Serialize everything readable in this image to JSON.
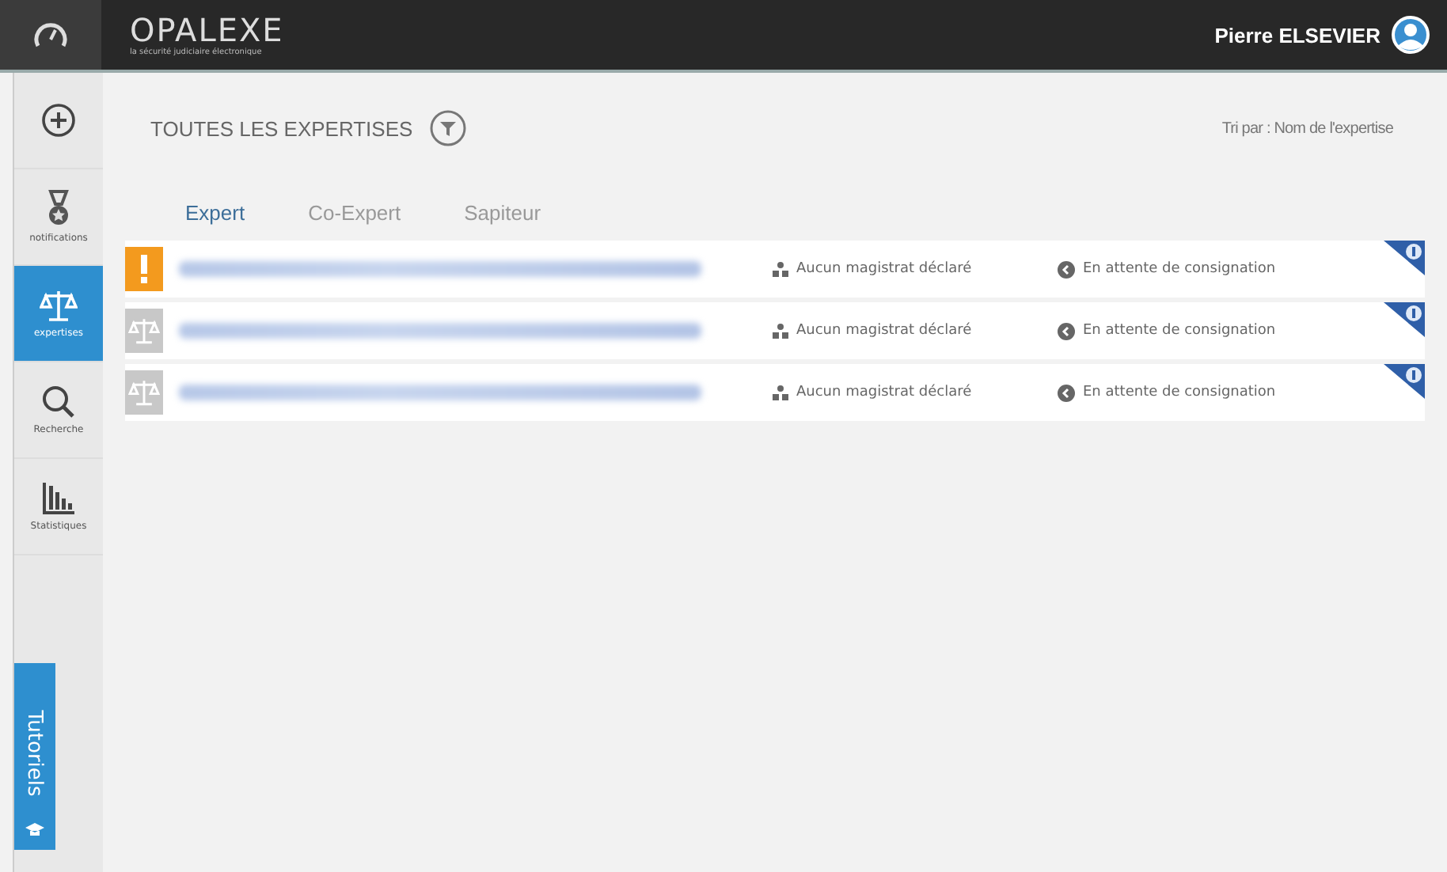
{
  "header": {
    "logo": "OPALEXE",
    "tagline": "la sécurité judiciaire électronique",
    "user": "Pierre ELSEVIER"
  },
  "sidebar": {
    "items": [
      {
        "kind": "add",
        "selected": false
      },
      {
        "kind": "medal",
        "label": "notifications",
        "selected": false
      },
      {
        "kind": "scales",
        "label": "expertises",
        "selected": true
      },
      {
        "kind": "search",
        "label": "Recherche",
        "selected": false
      },
      {
        "kind": "chart",
        "label": "Statistiques",
        "selected": false
      }
    ],
    "tutorials": "Tutoriels"
  },
  "title": "TOUTES LES EXPERTISES",
  "sort": "Tri par : Nom de l'expertise",
  "tabs": [
    {
      "label": "Expert",
      "selected": true
    },
    {
      "label": "Co-Expert",
      "selected": false
    },
    {
      "label": "Sapiteur",
      "selected": false
    }
  ],
  "rows": [
    {
      "kind": "alert",
      "magistrate": "Aucun magistrat déclaré",
      "status": "En attente de consignation"
    },
    {
      "kind": "case",
      "magistrate": "Aucun magistrat déclaré",
      "status": "En attente de consignation"
    },
    {
      "kind": "case",
      "magistrate": "Aucun magistrat déclaré",
      "status": "En attente de consignation"
    }
  ]
}
